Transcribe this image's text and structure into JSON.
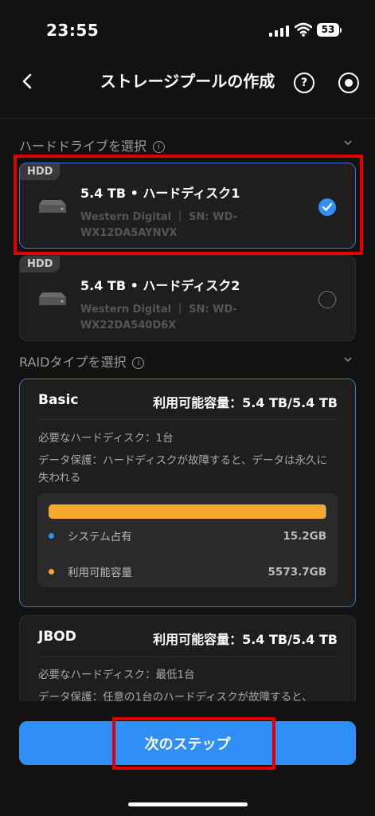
{
  "status_bar": {
    "time": "23:55",
    "battery": "53"
  },
  "header": {
    "title": "ストレージプールの作成",
    "help_symbol": "?"
  },
  "drive_section": {
    "label": "ハードドライブを選択",
    "info_symbol": "i"
  },
  "drives": [
    {
      "tag": "HDD",
      "title": "5.4 TB • ハードディスク1",
      "subtitle": "Western Digital ｜ SN: WD-WX12DA5AYNVX",
      "selected": true
    },
    {
      "tag": "HDD",
      "title": "5.4 TB • ハードディスク2",
      "subtitle": "Western Digital ｜ SN: WD-WX22DA540D6X",
      "selected": false
    }
  ],
  "raid_section": {
    "label": "RAIDタイプを選択",
    "info_symbol": "i"
  },
  "raid_options": [
    {
      "name": "Basic",
      "capacity": "利用可能容量：5.4 TB/5.4 TB",
      "required": "必要なハードディスク：1台",
      "protection": "データ保護：ハードディスクが故障すると、データは永久に失われる",
      "usage": {
        "system_label": "システム占有",
        "system_value": "15.2GB",
        "available_label": "利用可能容量",
        "available_value": "5573.7GB",
        "available_fraction": 0.997
      },
      "selected": true
    },
    {
      "name": "JBOD",
      "capacity": "利用可能容量：5.4 TB/5.4 TB",
      "required": "必要なハードディスク：最低1台",
      "protection": "データ保護：任意の1台のハードディスクが故障すると、",
      "selected": false
    }
  ],
  "footer": {
    "next_label": "次のステップ"
  },
  "colors": {
    "accent": "#2f8ff6",
    "available": "#f7a92e",
    "system": "#2f8ff6",
    "highlight": "#e00000"
  }
}
